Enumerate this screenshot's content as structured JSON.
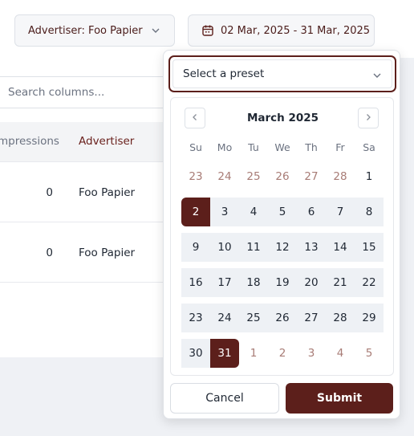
{
  "filters": {
    "advertiser_label": "Advertiser: Foo Papier",
    "date_range_label": "02 Mar, 2025 - 31 Mar, 2025"
  },
  "table": {
    "search_placeholder": "Search columns...",
    "columns": [
      "mpressions",
      "Advertiser"
    ],
    "rows": [
      {
        "impressions": "0",
        "advertiser": "Foo Papier"
      },
      {
        "impressions": "0",
        "advertiser": "Foo Papier"
      }
    ]
  },
  "datepicker": {
    "preset_placeholder": "Select a preset",
    "month_title": "March 2025",
    "weekdays": [
      "Su",
      "Mo",
      "Tu",
      "We",
      "Th",
      "Fr",
      "Sa"
    ],
    "weeks": [
      [
        "23",
        "24",
        "25",
        "26",
        "27",
        "28",
        "1"
      ],
      [
        "2",
        "3",
        "4",
        "5",
        "6",
        "7",
        "8"
      ],
      [
        "9",
        "10",
        "11",
        "12",
        "13",
        "14",
        "15"
      ],
      [
        "16",
        "17",
        "18",
        "19",
        "20",
        "21",
        "22"
      ],
      [
        "23",
        "24",
        "25",
        "26",
        "27",
        "28",
        "29"
      ],
      [
        "30",
        "31",
        "1",
        "2",
        "3",
        "4",
        "5"
      ]
    ],
    "range_start": "2",
    "range_end": "31",
    "cancel_label": "Cancel",
    "submit_label": "Submit"
  },
  "colors": {
    "accent": "#5c1f1b",
    "range_fill": "#eef1f5",
    "outside_day": "#a87c76"
  },
  "icons": {
    "date_filter": "calendar-icon",
    "dropdown": "chevron-down-icon",
    "prev": "chevron-left-icon",
    "next": "chevron-right-icon"
  }
}
